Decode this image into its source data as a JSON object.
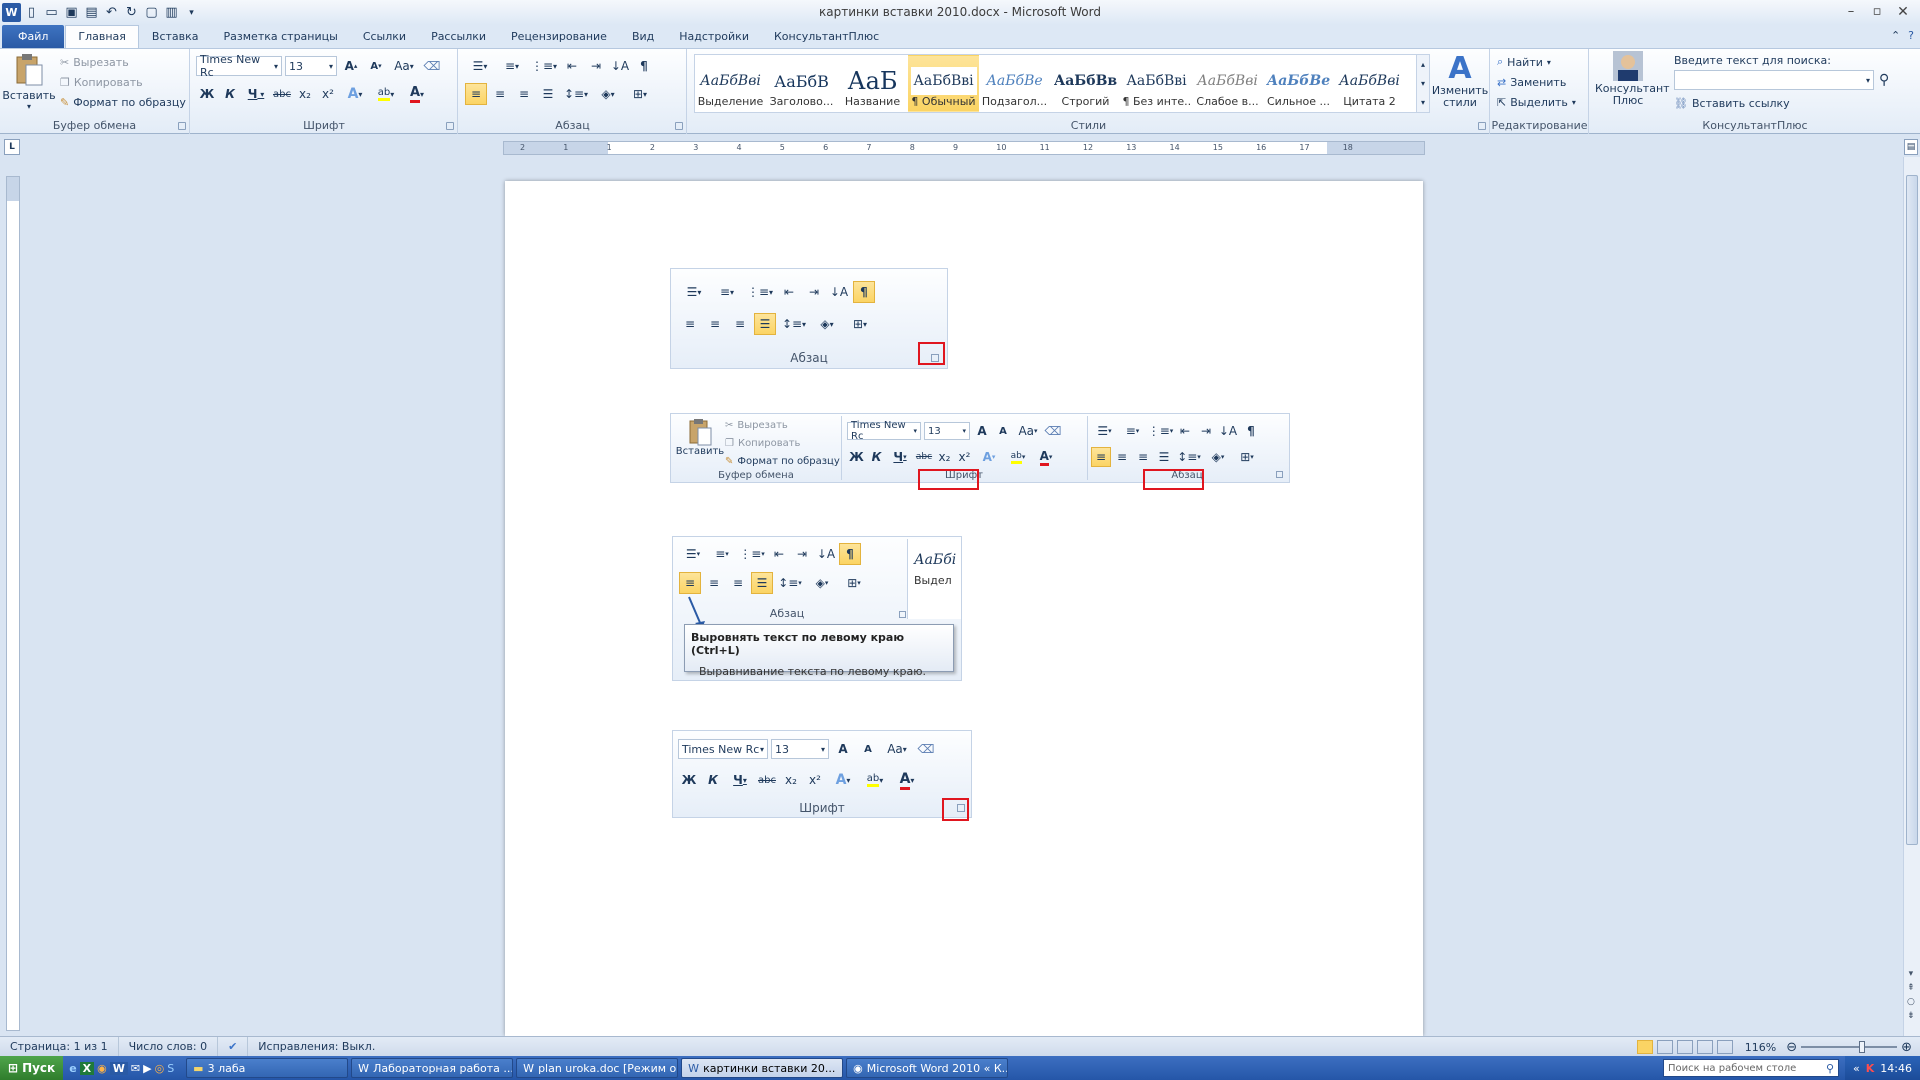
{
  "window": {
    "title": "картинки вставки 2010.docx - Microsoft Word"
  },
  "tabs": [
    "Файл",
    "Главная",
    "Вставка",
    "Разметка страницы",
    "Ссылки",
    "Рассылки",
    "Рецензирование",
    "Вид",
    "Надстройки",
    "КонсультантПлюс"
  ],
  "clipboard": {
    "paste": "Вставить",
    "cut": "Вырезать",
    "copy": "Копировать",
    "format_painter": "Формат по образцу",
    "label": "Буфер обмена"
  },
  "font": {
    "name": "Times New Rc",
    "size": "13",
    "label": "Шрифт",
    "case": "Aa",
    "bold": "Ж",
    "italic": "К",
    "underline": "Ч",
    "strike": "abc",
    "sub": "x₂",
    "sup": "x²"
  },
  "paragraph": {
    "label": "Абзац"
  },
  "styles": {
    "label": "Стили",
    "items": [
      {
        "preview": "АаБбВві",
        "name": "Выделение"
      },
      {
        "preview": "АаБбВ",
        "name": "Заголово..."
      },
      {
        "preview": "АаБ",
        "name": "Название"
      },
      {
        "preview": "АаБбВві",
        "name": "¶ Обычный"
      },
      {
        "preview": "АаБбВе",
        "name": "Подзагол..."
      },
      {
        "preview": "АаБбВв",
        "name": "Строгий"
      },
      {
        "preview": "АаБбВві",
        "name": "¶ Без инте..."
      },
      {
        "preview": "АаБбВві",
        "name": "Слабое в..."
      },
      {
        "preview": "АаБбВе",
        "name": "Сильное ..."
      },
      {
        "preview": "АаБбВві",
        "name": "Цитата 2"
      }
    ],
    "change": "Изменить стили"
  },
  "editing": {
    "find": "Найти",
    "replace": "Заменить",
    "select": "Выделить",
    "label": "Редактирование"
  },
  "consultant": {
    "button": "Консультант Плюс",
    "search_label": "Введите текст для поиска:",
    "insert_link": "Вставить ссылку",
    "label": "КонсультантПлюс"
  },
  "ruler_numbers": [
    "2",
    "1",
    "1",
    "2",
    "3",
    "4",
    "5",
    "6",
    "7",
    "8",
    "9",
    "10",
    "11",
    "12",
    "13",
    "14",
    "15",
    "16",
    "17",
    "18"
  ],
  "embedded": {
    "para_label": "Абзац",
    "font_label": "Шрифт",
    "clipboard_label": "Буфер обмена",
    "tooltip_title": "Выровнять текст по левому краю (Ctrl+L)",
    "tooltip_desc": "Выравнивание текста по левому краю.",
    "style_preview": "АаБбі",
    "style_name": "Выдел"
  },
  "status": {
    "page": "Страница: 1 из 1",
    "words": "Число слов: 0",
    "track": "Исправления: Выкл.",
    "zoom": "116%"
  },
  "taskbar": {
    "start": "Пуск",
    "tasks": [
      "3 лаба",
      "Лабораторная работа ...",
      "plan uroka.doc [Режим о...",
      "картинки вставки 20...",
      "Microsoft Word 2010 « К..."
    ],
    "search_placeholder": "Поиск на рабочем столе",
    "time": "14:46"
  },
  "colors": {
    "accent": "#2a5aa5",
    "highlight": "#fbd464",
    "red_box": "#e0161f"
  }
}
